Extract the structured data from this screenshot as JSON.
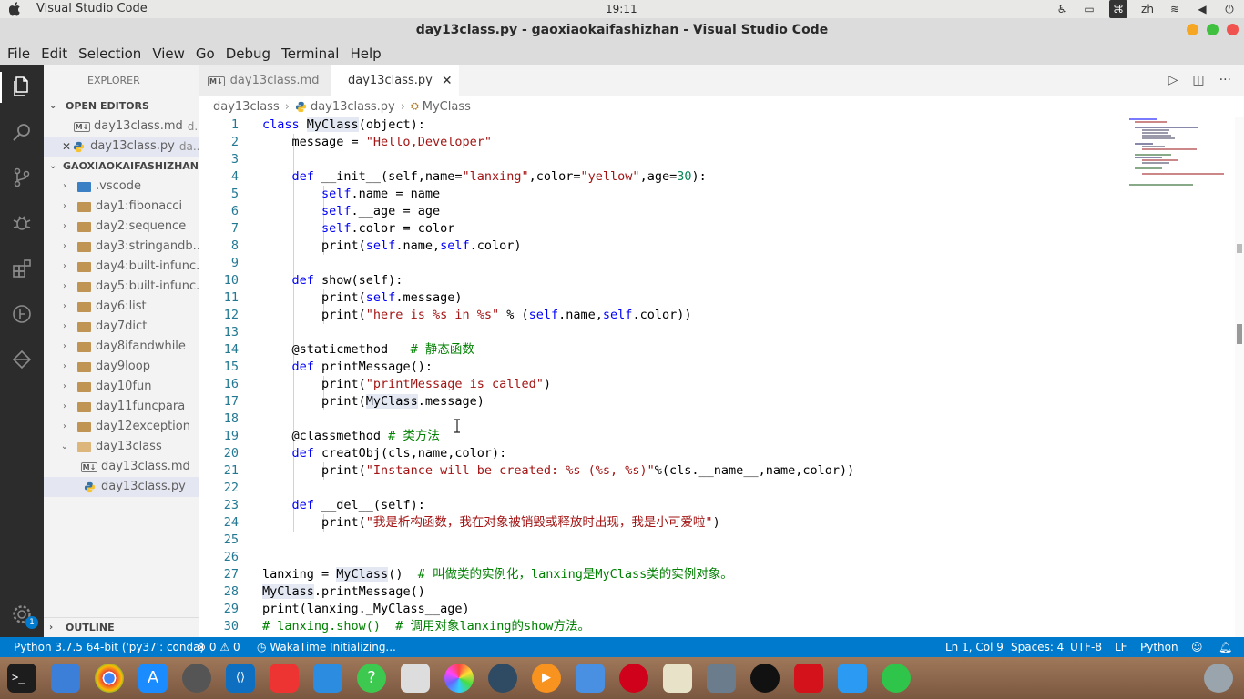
{
  "system": {
    "app_name": "Visual Studio Code",
    "clock": "19:11",
    "input_method": "zh"
  },
  "window": {
    "title": "day13class.py - gaoxiaokaifashizhan - Visual Studio Code"
  },
  "menu": [
    "File",
    "Edit",
    "Selection",
    "View",
    "Go",
    "Debug",
    "Terminal",
    "Help"
  ],
  "sidebar": {
    "header": "EXPLORER",
    "open_editors_label": "OPEN EDITORS",
    "open_editors": [
      {
        "name": "day13class.md",
        "dir": "d..."
      },
      {
        "name": "day13class.py",
        "dir": "da..."
      }
    ],
    "project_label": "GAOXIAOKAIFASHIZHAN",
    "tree": [
      {
        "name": ".vscode"
      },
      {
        "name": "day1:fibonacci"
      },
      {
        "name": "day2:sequence"
      },
      {
        "name": "day3:stringandb..."
      },
      {
        "name": "day4:built-infunc..."
      },
      {
        "name": "day5:built-infunc..."
      },
      {
        "name": "day6:list"
      },
      {
        "name": "day7dict"
      },
      {
        "name": "day8ifandwhile"
      },
      {
        "name": "day9loop"
      },
      {
        "name": "day10fun"
      },
      {
        "name": "day11funcpara"
      },
      {
        "name": "day12exception"
      },
      {
        "name": "day13class"
      },
      {
        "name": "day13class.md"
      },
      {
        "name": "day13class.py"
      }
    ],
    "outline_label": "OUTLINE"
  },
  "tabs": [
    {
      "label": "day13class.md"
    },
    {
      "label": "day13class.py"
    }
  ],
  "breadcrumb": [
    "day13class",
    "day13class.py",
    "MyClass"
  ],
  "code_lines": [
    {
      "n": "1",
      "html": "<span class=\"kw\">class</span> <span class=\"hl\">MyClass</span>(object):"
    },
    {
      "n": "2",
      "html": "    message = <span class=\"str\">\"Hello,Developer\"</span>"
    },
    {
      "n": "3",
      "html": ""
    },
    {
      "n": "4",
      "html": "    <span class=\"kw\">def</span> __init__(self,name=<span class=\"str\">\"lanxing\"</span>,color=<span class=\"str\">\"yellow\"</span>,age=<span class=\"num\">30</span>):"
    },
    {
      "n": "5",
      "html": "        <span class=\"slf\">self</span>.name = name"
    },
    {
      "n": "6",
      "html": "        <span class=\"slf\">self</span>.__age = age"
    },
    {
      "n": "7",
      "html": "        <span class=\"slf\">self</span>.color = color"
    },
    {
      "n": "8",
      "html": "        print(<span class=\"slf\">self</span>.name,<span class=\"slf\">self</span>.color)"
    },
    {
      "n": "9",
      "html": ""
    },
    {
      "n": "10",
      "html": "    <span class=\"kw\">def</span> show(self):"
    },
    {
      "n": "11",
      "html": "        print(<span class=\"slf\">self</span>.message)"
    },
    {
      "n": "12",
      "html": "        print(<span class=\"str\">\"here is %s in %s\"</span> % (<span class=\"slf\">self</span>.name,<span class=\"slf\">self</span>.color))"
    },
    {
      "n": "13",
      "html": ""
    },
    {
      "n": "14",
      "html": "    @staticmethod   <span class=\"cmt\"># 静态函数</span>"
    },
    {
      "n": "15",
      "html": "    <span class=\"kw\">def</span> printMessage():"
    },
    {
      "n": "16",
      "html": "        print(<span class=\"str\">\"printMessage is called\"</span>)"
    },
    {
      "n": "17",
      "html": "        print(<span class=\"hl\">MyClass</span>.message)"
    },
    {
      "n": "18",
      "html": ""
    },
    {
      "n": "19",
      "html": "    @classmethod <span class=\"cmt\"># 类方法</span>"
    },
    {
      "n": "20",
      "html": "    <span class=\"kw\">def</span> creatObj(cls,name,color):"
    },
    {
      "n": "21",
      "html": "        print(<span class=\"str\">\"Instance will be created: %s (%s, %s)\"</span>%(cls.__name__,name,color))"
    },
    {
      "n": "22",
      "html": ""
    },
    {
      "n": "23",
      "html": "    <span class=\"kw\">def</span> __del__(self):"
    },
    {
      "n": "24",
      "html": "        print(<span class=\"str\">\"我是析构函数，我在对象被销毁或释放时出现，我是小可爱啦\"</span>)"
    },
    {
      "n": "25",
      "html": ""
    },
    {
      "n": "26",
      "html": ""
    },
    {
      "n": "27",
      "html": "lanxing = <span class=\"hl\">MyClass</span>()  <span class=\"cmt\"># 叫做类的实例化，lanxing是MyClass类的实例对象。</span>"
    },
    {
      "n": "28",
      "html": "<span class=\"hl\">MyClass</span>.printMessage()"
    },
    {
      "n": "29",
      "html": "print(lanxing._MyClass__age)"
    },
    {
      "n": "30",
      "html": "<span class=\"cmt\"># lanxing.show()  # 调用对象lanxing的show方法。</span>"
    }
  ],
  "status": {
    "interpreter": "Python 3.7.5 64-bit ('py37': conda)",
    "errors": "0",
    "warnings": "0",
    "wakatime": "WakaTime Initializing...",
    "position": "Ln 1, Col 9",
    "spaces": "Spaces: 4",
    "encoding": "UTF-8",
    "eol": "LF",
    "language": "Python"
  },
  "activity_badge": "1",
  "colors": {
    "accent": "#007acc",
    "statusbar": "#007acc"
  }
}
